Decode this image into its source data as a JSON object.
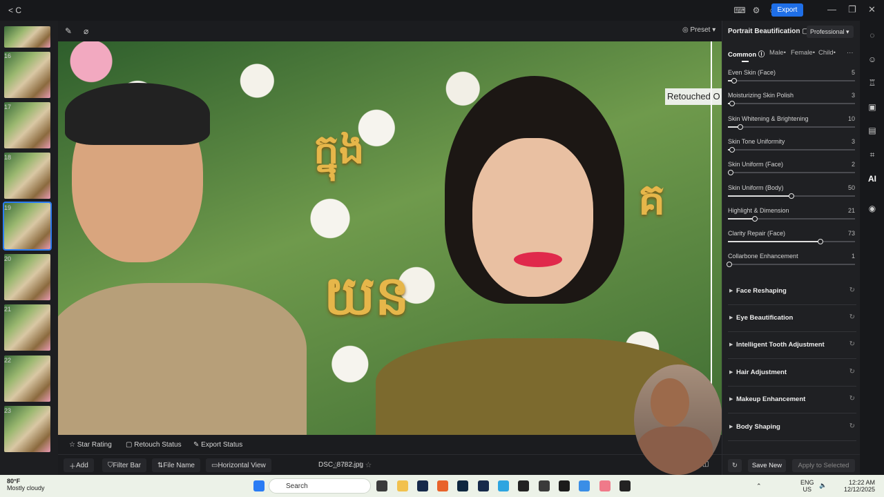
{
  "titlebar": {
    "back": "< C",
    "export_label": "Export"
  },
  "filmstrip": {
    "numbers": [
      "16",
      "17",
      "18",
      "19",
      "20",
      "21",
      "22",
      "23"
    ]
  },
  "canvas": {
    "preset_label": "Preset",
    "retouched_label": "Retouched",
    "overlay_text": [
      "ក្នុង",
      "យន",
      "គ"
    ]
  },
  "statusbar": {
    "star_rating": "Star Rating",
    "retouch_status": "Retouch Status",
    "export_status": "Export Status",
    "add": "Add",
    "filter_bar": "Filter Bar",
    "file_name": "File Name",
    "horizontal_view": "Horizontal View",
    "filename": "DSC_8782.jpg"
  },
  "panel": {
    "title": "Portrait Beautification",
    "mode": "Professional",
    "tabs": [
      "Common",
      "Male",
      "Female",
      "Child"
    ],
    "sliders": [
      {
        "label": "Even Skin (Face)",
        "value": 5
      },
      {
        "label": "Moisturizing Skin Polish",
        "value": 3
      },
      {
        "label": "Skin Whitening & Brightening",
        "value": 10
      },
      {
        "label": "Skin Tone Uniformity",
        "value": 3
      },
      {
        "label": "Skin Uniform (Face)",
        "value": 2
      },
      {
        "label": "Skin Uniform (Body)",
        "value": 50
      },
      {
        "label": "Highlight & Dimension",
        "value": 21
      },
      {
        "label": "Clarity Repair (Face)",
        "value": 73
      },
      {
        "label": "Collarbone Enhancement",
        "value": 1
      }
    ],
    "sections": [
      "Face Reshaping",
      "Eye Beautification",
      "Intelligent Tooth Adjustment",
      "Hair Adjustment",
      "Makeup Enhancement",
      "Body Shaping"
    ],
    "save_new": "Save New",
    "apply_selected": "Apply to Selected"
  },
  "taskbar": {
    "temp": "80°F",
    "weather": "Mostly cloudy",
    "search": "Search",
    "lang": "ENG",
    "region": "US",
    "time": "12:22 AM",
    "date": "12/12/2025"
  },
  "colors": {
    "accent": "#1f6fe8",
    "panel_bg": "#1f2023"
  }
}
